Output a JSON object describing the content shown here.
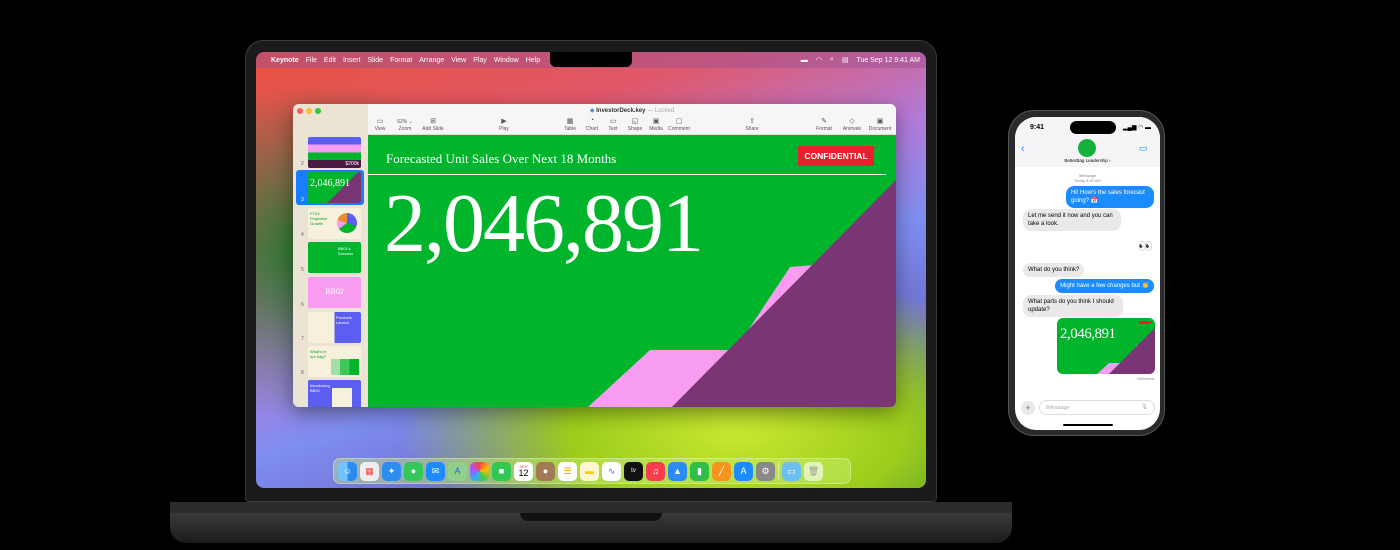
{
  "menubar": {
    "app": "Keynote",
    "items": [
      "File",
      "Edit",
      "Insert",
      "Slide",
      "Format",
      "Arrange",
      "View",
      "Play",
      "Window",
      "Help"
    ],
    "datetime": "Tue Sep 12  9:41 AM"
  },
  "window": {
    "filename": "InvestorDeck.key",
    "status": "— Locked",
    "toolbar": [
      {
        "label": "View",
        "icon": "sidebar-icon"
      },
      {
        "label": "62% ⌄",
        "icon": ""
      },
      {
        "label": "Add Slide",
        "icon": "add-slide-icon"
      },
      {
        "label": "Play",
        "icon": "play-icon"
      },
      {
        "label": "Table",
        "icon": "table-icon"
      },
      {
        "label": "Chart",
        "icon": "chart-icon"
      },
      {
        "label": "Text",
        "icon": "text-icon"
      },
      {
        "label": "Shape",
        "icon": "shape-icon"
      },
      {
        "label": "Media",
        "icon": "media-icon"
      },
      {
        "label": "Comment",
        "icon": "comment-icon"
      },
      {
        "label": "Share",
        "icon": "share-icon"
      },
      {
        "label": "Format",
        "icon": "format-icon"
      },
      {
        "label": "Animate",
        "icon": "animate-icon"
      },
      {
        "label": "Document",
        "icon": "document-icon"
      }
    ],
    "zoom_label": "Zoom",
    "slides": [
      {
        "n": "2",
        "text": "$200k"
      },
      {
        "n": "3",
        "text": "2,046,891"
      },
      {
        "n": "4",
        "text": "FY24 Projected Growth"
      },
      {
        "n": "5",
        "text": "BB01's Success"
      },
      {
        "n": "6",
        "text": "BB02"
      },
      {
        "n": "7",
        "text": "Products Launch"
      },
      {
        "n": "8",
        "text": "What's in our bag?"
      },
      {
        "n": "9",
        "text": "Introducing BB02"
      }
    ]
  },
  "slide": {
    "title": "Forecasted Unit Sales Over Next 18 Months",
    "badge": "CONFIDENTIAL",
    "number": "2,046,891",
    "colors": {
      "green": "#00b52b",
      "pink": "#f79cf0",
      "purple": "#7a3575",
      "red": "#e8202e"
    }
  },
  "dock": [
    "finder",
    "launchpad",
    "safari",
    "messages",
    "mail",
    "maps",
    "photos",
    "facetime",
    "calendar",
    "contacts",
    "reminders",
    "notes",
    "freeform",
    "tv",
    "music",
    "keynote",
    "numbers",
    "pages",
    "app-store",
    "system-settings",
    "downloads",
    "trash"
  ],
  "dock_calendar": {
    "month": "SEP",
    "day": "12"
  },
  "dock_tv": "tv",
  "phone": {
    "time": "9:41",
    "contact": "BetterBag Leadership ›",
    "service": "iMessage",
    "timestamp": "Today 9:37 AM",
    "messages": [
      {
        "from": "me",
        "text": "Hi! How's the sales forecast going? 📅"
      },
      {
        "from": "them",
        "text": "Let me send it now and you can take a look."
      },
      {
        "from": "me",
        "text": "👀"
      },
      {
        "from": "them",
        "text": "What do you think?"
      },
      {
        "from": "me",
        "text": "Might have a few changes but 👏"
      },
      {
        "from": "them",
        "text": "What parts do you think I should update?"
      }
    ],
    "attachment_number": "2,046,891",
    "delivered": "Delivered",
    "input_placeholder": "iMessage"
  }
}
